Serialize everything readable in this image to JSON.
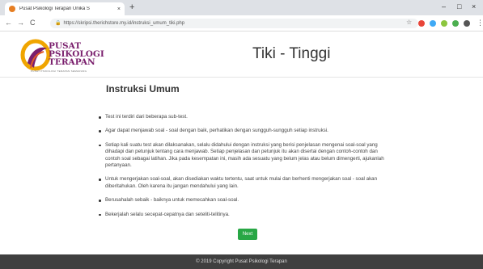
{
  "browser": {
    "tab_title": "Pusat Psikologi Terapan Unika S",
    "tab_close": "×",
    "new_tab": "+",
    "url": "https://skripsi.therichstore.my.id/instruksi_umum_tiki.php",
    "back": "←",
    "forward": "→",
    "reload": "C",
    "star": "☆",
    "minimize": "–",
    "maximize": "□",
    "close": "×",
    "menu": "⋮"
  },
  "logo": {
    "line1": "PUSAT",
    "line2": "PSIKOLOGI",
    "line3": "TERAPAN",
    "tagline": "PUSAT PSIKOLOGI TERAPAN SEMARANG"
  },
  "header": {
    "title": "Tiki - Tinggi"
  },
  "main": {
    "title": "Instruksi Umum",
    "items": [
      "Test ini terdiri dari beberapa sub-test.",
      "Agar dapat menjawab soal - soal dengan baik, perhatikan dengan sungguh-sungguh setiap instruksi.",
      "Setiap kali suatu test akan dilaksanakan, selalu didahului dengan instruksi yang berisi penjelasan mengenai soal-soal yang dihadapi dan petunjuk tentang cara menjawab. Setiap penjelasan dan petunjuk itu akan disertai dengan contoh-contoh dan contoh soal sebagai latihan. Jika pada kesempatan ini, masih ada sesuatu yang belum jelas atau belum dimengerti, ajukanlah pertanyaan.",
      "Untuk mengerjakan soal-soal, akan disediakan waktu tertentu, saat untuk mulai dan berhenti mengerjakan soal - soal akan diberitahukan. Oleh karena itu jangan mendahului yang lain.",
      "Berusahalah sebaik - baiknya untuk memecahkan soal-soal.",
      "Bekerjalah selalu secepat-cepatnya dan seteliti-telitinya."
    ],
    "next_label": "Next"
  },
  "footer": {
    "text": "© 2019 Copyright Pusat Psikologi Terapan"
  },
  "colors": {
    "next_button": "#28a745",
    "footer_bg": "#3f3f3f",
    "logo_purple": "#7a1f6d"
  }
}
